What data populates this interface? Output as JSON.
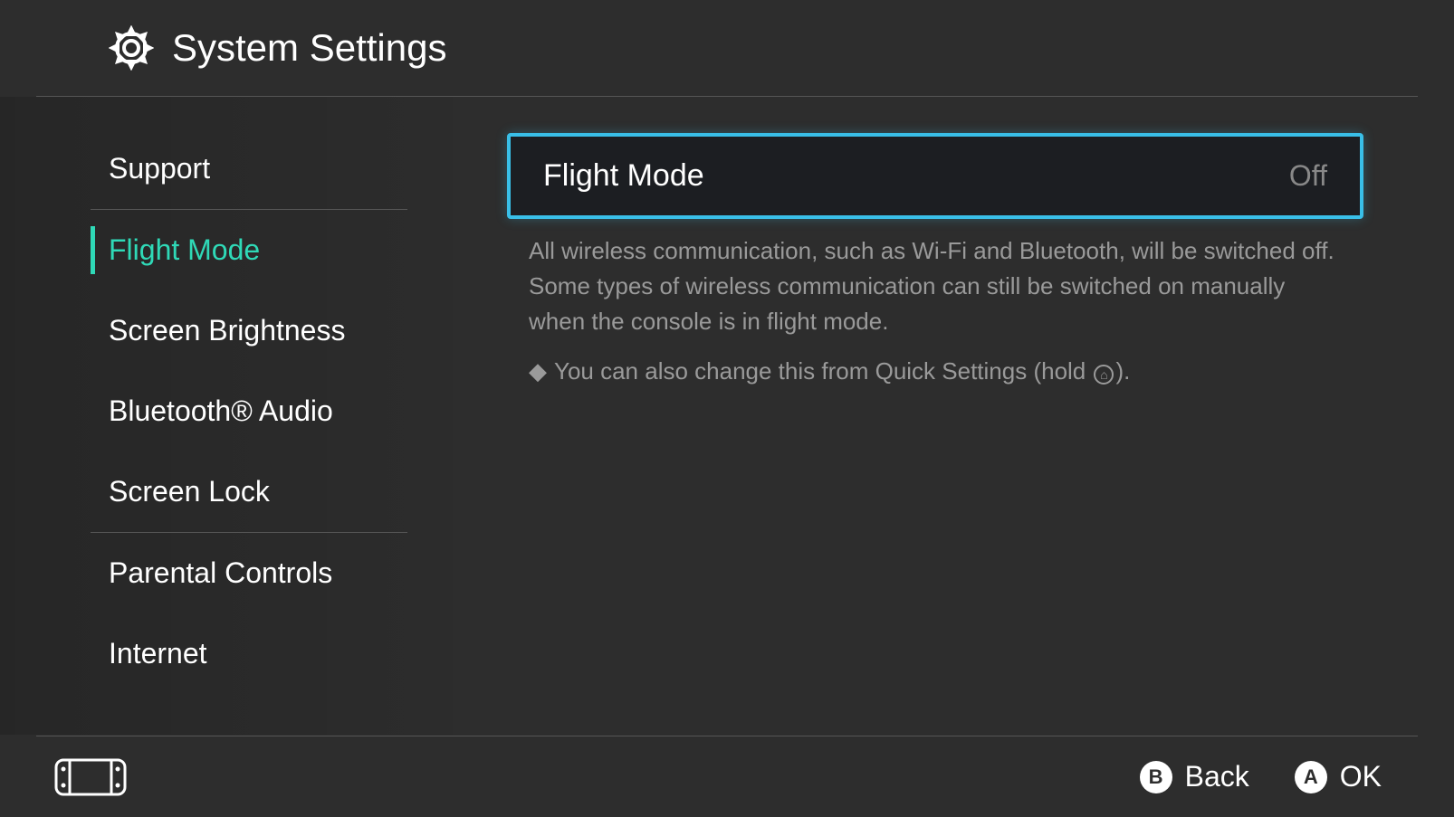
{
  "header": {
    "title": "System Settings"
  },
  "sidebar": {
    "items": [
      {
        "label": "Support",
        "active": false
      },
      {
        "label": "Flight Mode",
        "active": true
      },
      {
        "label": "Screen Brightness",
        "active": false
      },
      {
        "label": "Bluetooth® Audio",
        "active": false
      },
      {
        "label": "Screen Lock",
        "active": false
      },
      {
        "label": "Parental Controls",
        "active": false
      },
      {
        "label": "Internet",
        "active": false
      }
    ]
  },
  "main": {
    "setting_label": "Flight Mode",
    "setting_value": "Off",
    "description": "All wireless communication, such as Wi-Fi and Bluetooth, will be switched off. Some types of wireless communication can still be switched on manually when the console is in flight mode.",
    "hint_prefix": "◆",
    "hint_text_pre": "You can also change this from Quick Settings (hold ",
    "hint_text_post": ")."
  },
  "footer": {
    "back_glyph": "B",
    "back_label": "Back",
    "ok_glyph": "A",
    "ok_label": "OK"
  }
}
